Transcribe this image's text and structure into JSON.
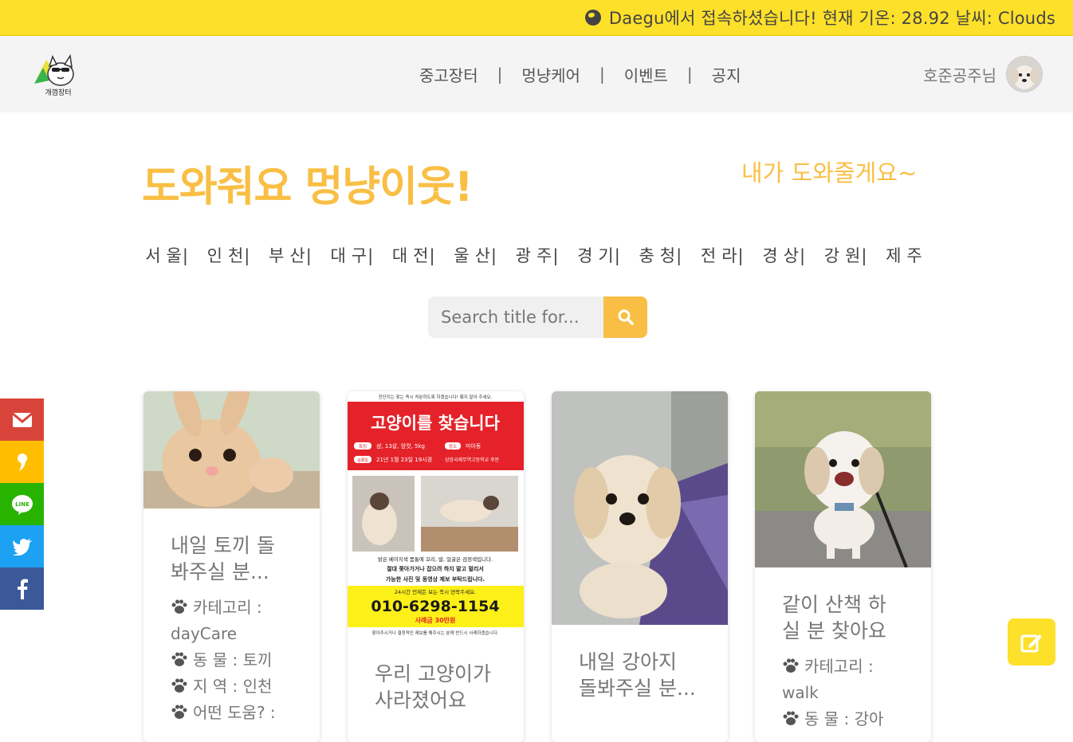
{
  "topbar": {
    "weather_text": "Daegu에서 접속하셨습니다! 현재 기온: 28.92 날씨: Clouds"
  },
  "logo": {
    "text": "개껌장터"
  },
  "nav": {
    "items": [
      "중고장터",
      "멍냥케어",
      "이벤트",
      "공지"
    ],
    "separator": "|"
  },
  "user": {
    "name": "호준공주님"
  },
  "hero": {
    "title": "도와줘요 멍냥이웃!",
    "link": "내가 도와줄게요~"
  },
  "regions": [
    "서울",
    "인천",
    "부산",
    "대구",
    "대전",
    "울산",
    "광주",
    "경기",
    "충청",
    "전라",
    "경상",
    "강원",
    "제주"
  ],
  "search": {
    "placeholder": "Search title for..."
  },
  "cards": [
    {
      "title": "내일 토끼 돌봐주실 분...",
      "meta": [
        "카테고리 : dayCare",
        "동 물 : 토끼",
        "지 역 : 인천",
        "어떤 도움? :"
      ]
    },
    {
      "title": "우리 고양이가 사라졌어요",
      "poster": {
        "header": "전단지는 찾는 즉시 처분하도록 하겠습니다! 훼지 말아 주세요.",
        "title": "고양이를 찾습니다",
        "tag1": "특징",
        "info1": "샴, 13살, 암컷, 5kg",
        "tag2": "장소",
        "info2": "미아동",
        "tag3": "실종일",
        "info3": "21년 1월 23일 19시경",
        "info4": "상암국제무역고등학교 후문",
        "desc1": "밝은 베이지색 몸통에 꼬리, 발, 얼굴은 검정색입니다.",
        "desc2": "절대 쫓아가거나 잡으려 하지 말고 멀리서",
        "desc3": "가능한 사진 및 동영상 제보 부탁드립니다.",
        "call": "24시간 언제든 보는 즉시 연락주세요.",
        "phone": "010-6298-1154",
        "reward": "사례금 30만원",
        "footer": "찾아주시거나 결정적인 제보를 해주시는 분께 반드시 사례하겠습니다."
      }
    },
    {
      "title": "내일 강아지 돌봐주실 분..."
    },
    {
      "title": "같이 산책 하실 분 찾아요",
      "meta": [
        "카테고리 : walk",
        "동 물 : 강아"
      ]
    }
  ],
  "social": [
    {
      "name": "gmail",
      "color": "#d9443a",
      "glyph": "M"
    },
    {
      "name": "kakao",
      "color": "#ffbf00",
      "glyph": "❜"
    },
    {
      "name": "line",
      "color": "#27b300",
      "glyph": "LINE"
    },
    {
      "name": "twitter",
      "color": "#1da1f2",
      "glyph": "t"
    },
    {
      "name": "facebook",
      "color": "#3b5998",
      "glyph": "f"
    }
  ],
  "colors": {
    "accent": "#f9bf45",
    "banner": "#fde02a"
  }
}
